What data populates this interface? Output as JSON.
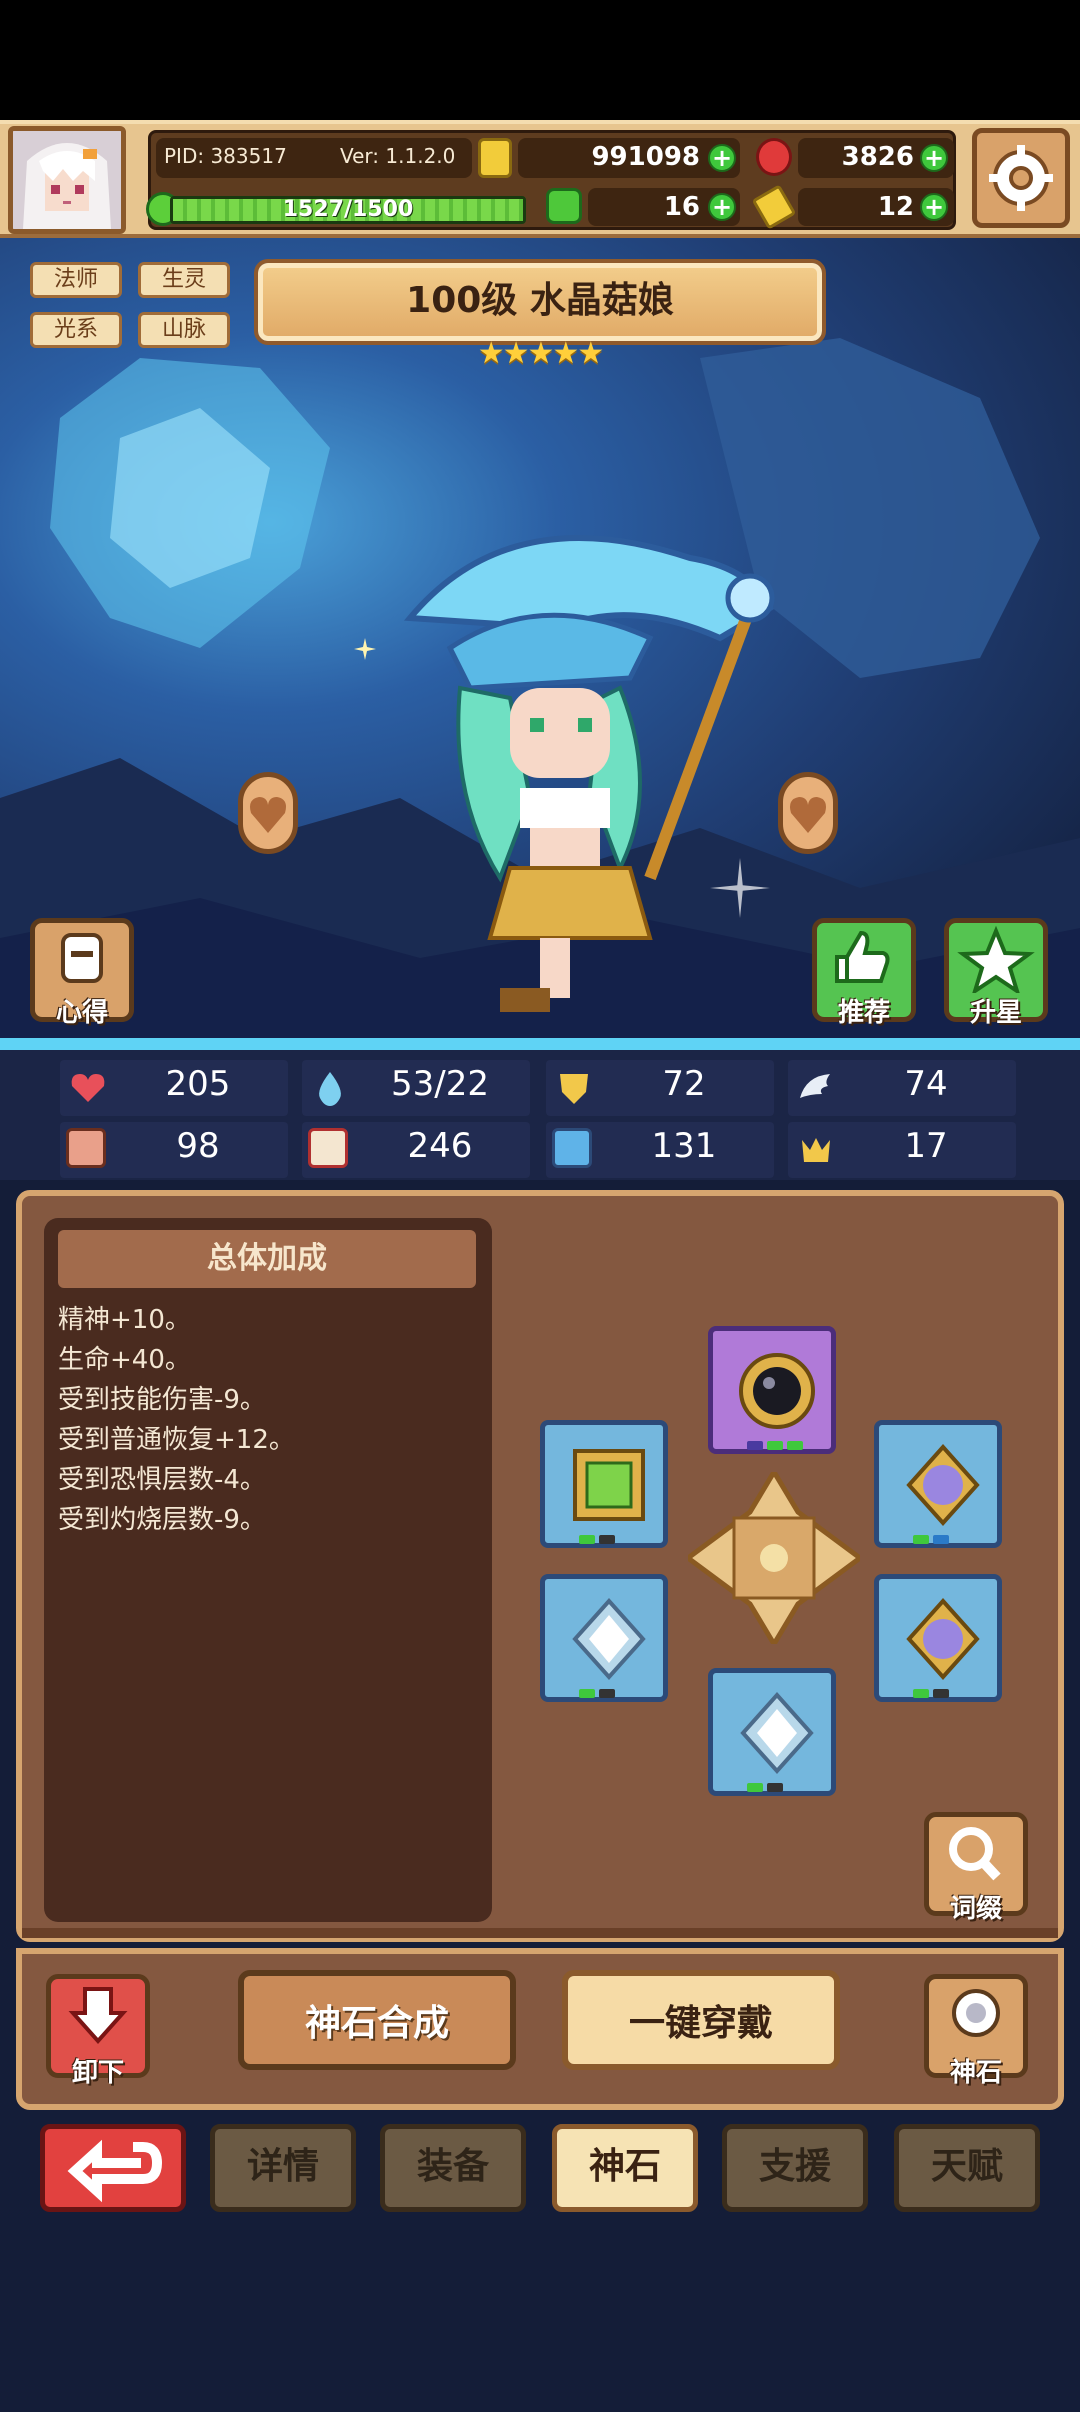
{
  "hud": {
    "pid": "PID: 383517",
    "version": "Ver: 1.1.2.0",
    "gold": "991098",
    "gems": "3826",
    "xp_text": "1527/1500",
    "xp_fraction": 1.0,
    "clover": "16",
    "key": "12"
  },
  "hero": {
    "tags": [
      "法师",
      "生灵",
      "光系",
      "山脉"
    ],
    "title": "100级 水晶菇娘",
    "stars": "★★★★★",
    "star_count": 5
  },
  "side_buttons": {
    "insight": "心得",
    "recommend": "推荐",
    "star_up": "升星"
  },
  "stats": {
    "hp": "205",
    "mana": "53/22",
    "defense": "72",
    "speed": "74",
    "fist": "98",
    "book": "246",
    "boot": "131",
    "crown": "17"
  },
  "bonus_panel": {
    "header": "总体加成",
    "lines": [
      "精神+10。",
      "生命+40。",
      "受到技能伤害-9。",
      "受到普通恢复+12。",
      "受到恐惧层数-4。",
      "受到灼烧层数-9。"
    ]
  },
  "affix_button": "词缀",
  "bottom_actions": {
    "unequip": "卸下",
    "synthesize": "神石合成",
    "auto_equip": "一键穿戴",
    "godstone": "神石"
  },
  "tabs": {
    "details": "详情",
    "equipment": "装备",
    "godstone": "神石",
    "support": "支援",
    "talent": "天赋"
  },
  "icons": {
    "back": "back-arrow-icon",
    "settings": "gear-icon",
    "gold": "gold-coin-icon",
    "gem": "red-gem-icon"
  },
  "colors": {
    "accent_green": "#3fc83c",
    "panel_brown": "#845840",
    "back_red": "#e2413f"
  }
}
